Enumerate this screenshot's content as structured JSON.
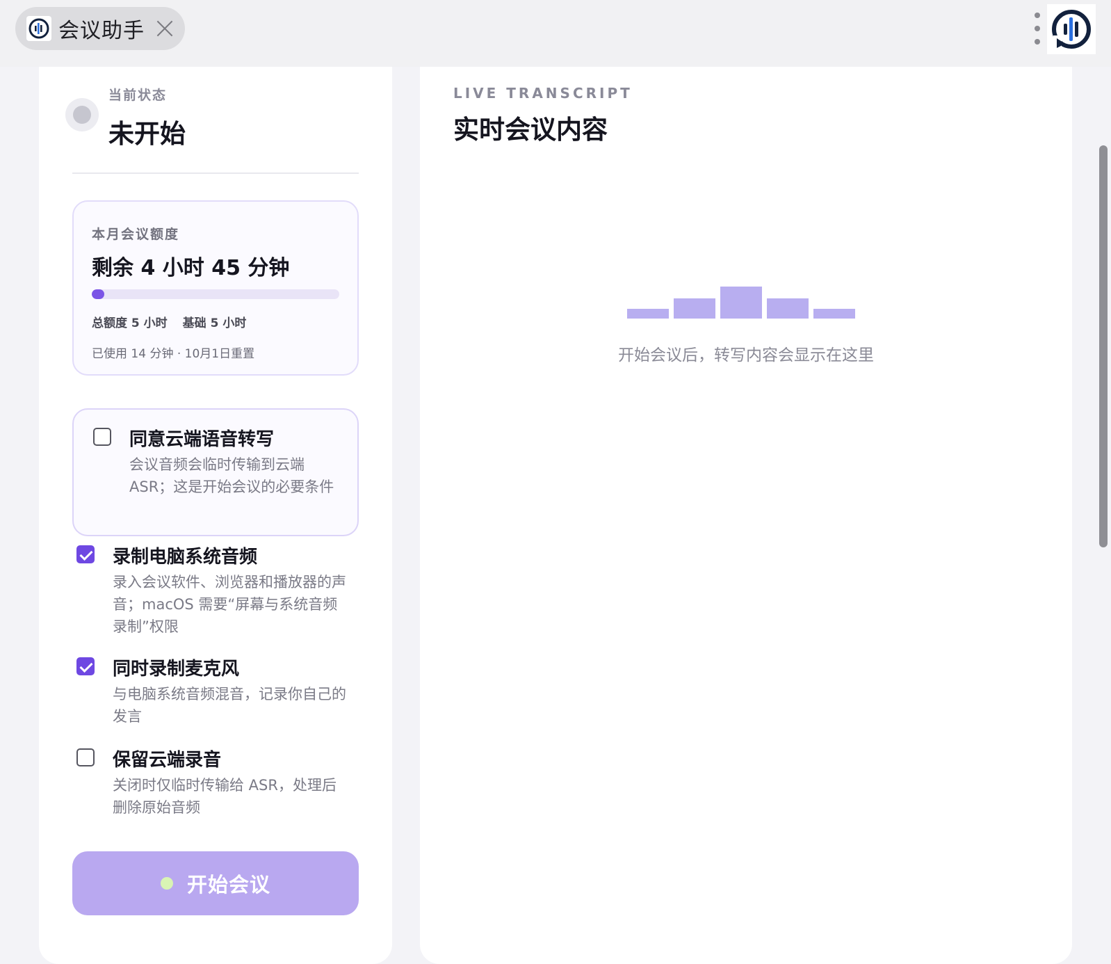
{
  "tab": {
    "title": "会议助手",
    "icon": "meeting-assistant-logo"
  },
  "status": {
    "label": "当前状态",
    "value": "未开始"
  },
  "quota": {
    "title": "本月会议额度",
    "remaining": "剩余 4 小时 45 分钟",
    "progress_fraction": 0.05,
    "total": "总额度 5 小时",
    "base": "基础 5 小时",
    "used": "已使用 14 分钟 · 10月1日重置"
  },
  "options": {
    "consent": {
      "title": "同意云端语音转写",
      "desc": "会议音频会临时传输到云端 ASR；这是开始会议的必要条件",
      "checked": false
    },
    "system_audio": {
      "title": "录制电脑系统音频",
      "desc": "录入会议软件、浏览器和播放器的声音；macOS 需要“屏幕与系统音频录制”权限",
      "checked": true
    },
    "microphone": {
      "title": "同时录制麦克风",
      "desc": "与电脑系统音频混音，记录你自己的发言",
      "checked": true
    },
    "keep_recording": {
      "title": "保留云端录音",
      "desc": "关闭时仅临时传输给 ASR，处理后删除原始音频",
      "checked": false
    }
  },
  "start_button": {
    "label": "开始会议"
  },
  "transcript": {
    "eyebrow": "LIVE TRANSCRIPT",
    "title": "实时会议内容",
    "empty_text": "开始会议后，转写内容会显示在这里",
    "placeholder_bar_levels": [
      0.3,
      0.62,
      1.0,
      0.62,
      0.3
    ]
  },
  "colors": {
    "accent": "#6e48e2",
    "button": "#b9a8f0",
    "placeholder_bars": "#b8aef0"
  }
}
